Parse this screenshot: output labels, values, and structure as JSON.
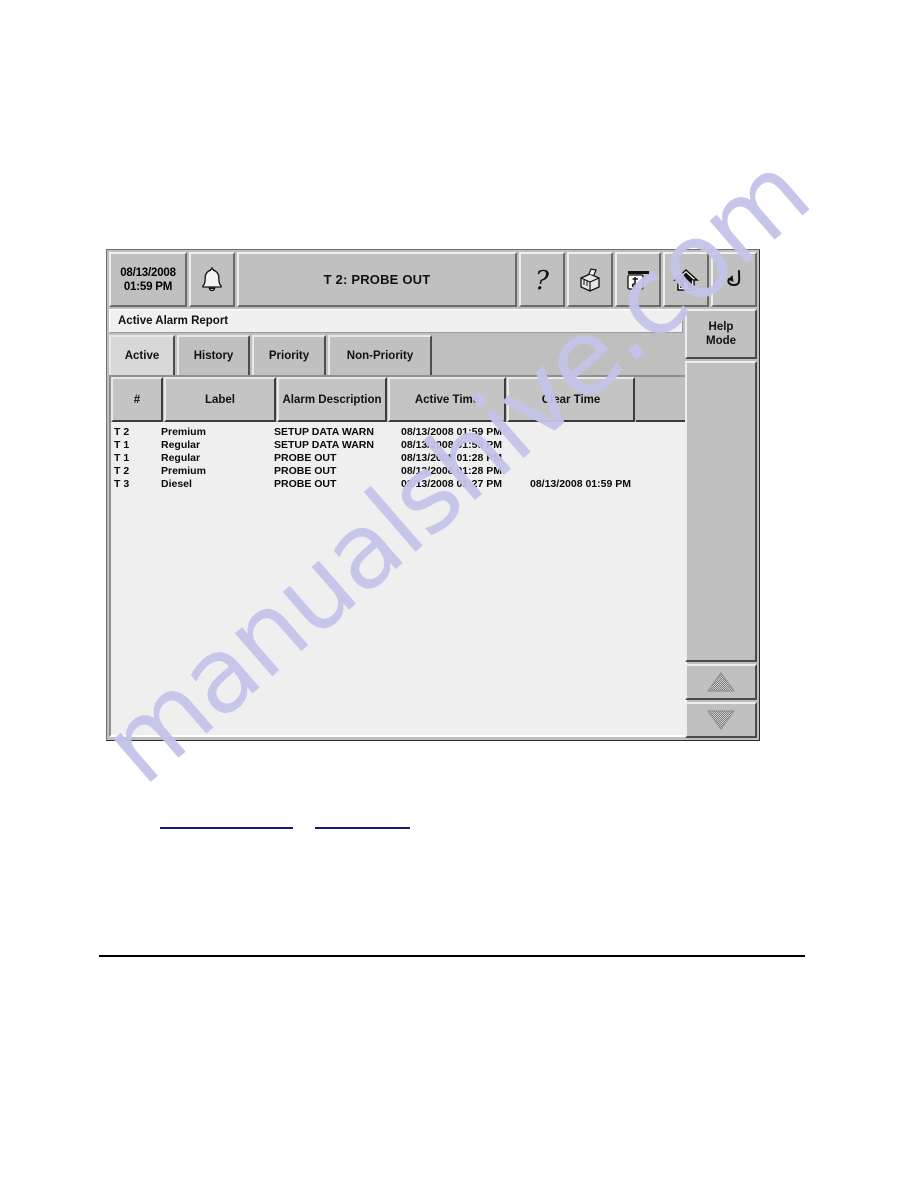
{
  "watermark": {
    "text": "manualshive.com",
    "color": "#c4c4ea"
  },
  "device": {
    "topbar": {
      "date": "08/13/2008",
      "time": "01:59 PM",
      "alarm_icon": "bell-icon",
      "status_title": "T 2: PROBE OUT",
      "buttons": [
        {
          "name": "help-button",
          "icon": "question-mark-icon"
        },
        {
          "name": "print-button",
          "icon": "printer-icon"
        },
        {
          "name": "tank-gauge-button",
          "icon": "tank-probe-icon"
        },
        {
          "name": "home-button",
          "icon": "home-icon"
        },
        {
          "name": "back-button",
          "icon": "return-arrow-icon"
        }
      ]
    },
    "report_title": "Active Alarm Report",
    "tabs": [
      {
        "label": "Active",
        "selected": true
      },
      {
        "label": "History",
        "selected": false
      },
      {
        "label": "Priority",
        "selected": false
      },
      {
        "label": "Non-Priority",
        "selected": false
      }
    ],
    "table": {
      "columns": [
        "#",
        "Label",
        "Alarm Description",
        "Active Time",
        "Clear Time"
      ],
      "rows": [
        {
          "num": "T 2",
          "label": "Premium",
          "description": "SETUP DATA WARN",
          "active_time": "08/13/2008 01:59 PM",
          "clear_time": ""
        },
        {
          "num": "T 1",
          "label": "Regular",
          "description": "SETUP DATA WARN",
          "active_time": "08/13/2008 01:59 PM",
          "clear_time": ""
        },
        {
          "num": "T 1",
          "label": "Regular",
          "description": "PROBE OUT",
          "active_time": "08/13/2008 01:28 PM",
          "clear_time": ""
        },
        {
          "num": "T 2",
          "label": "Premium",
          "description": "PROBE OUT",
          "active_time": "08/13/2008 01:28 PM",
          "clear_time": ""
        },
        {
          "num": "T 3",
          "label": "Diesel",
          "description": "PROBE OUT",
          "active_time": "08/13/2008 01:27 PM",
          "clear_time": "08/13/2008 01:59 PM"
        }
      ]
    },
    "sidebar": {
      "help_mode_line1": "Help",
      "help_mode_line2": "Mode",
      "scroll_up_icon": "triangle-up-icon",
      "scroll_down_icon": "triangle-down-icon"
    }
  }
}
